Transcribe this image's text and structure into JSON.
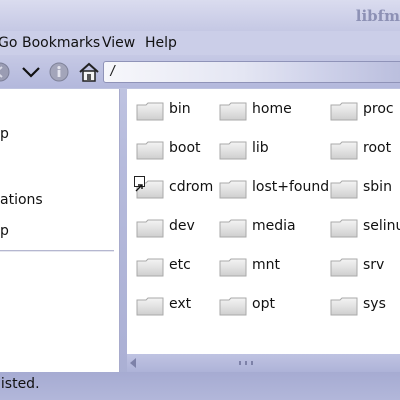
{
  "window": {
    "title": "libfm"
  },
  "menubar": {
    "items": [
      "Go",
      "Bookmarks",
      "View",
      "Help"
    ]
  },
  "toolbar": {
    "icons": [
      "back-icon",
      "dropdown-chevron-icon",
      "info-icon",
      "home-icon"
    ],
    "location": "/"
  },
  "sidepane": {
    "items": [
      "p",
      "ations",
      "p"
    ]
  },
  "files": [
    {
      "name": "bin"
    },
    {
      "name": "home"
    },
    {
      "name": "proc"
    },
    {
      "name": "boot"
    },
    {
      "name": "lib"
    },
    {
      "name": "root"
    },
    {
      "name": "cdrom",
      "symlink": true
    },
    {
      "name": "lost+found"
    },
    {
      "name": "sbin"
    },
    {
      "name": "dev"
    },
    {
      "name": "media"
    },
    {
      "name": "selinux"
    },
    {
      "name": "etc"
    },
    {
      "name": "mnt"
    },
    {
      "name": "srv"
    },
    {
      "name": "ext"
    },
    {
      "name": "opt"
    },
    {
      "name": "sys"
    }
  ],
  "statusbar": {
    "text": "listed."
  },
  "colors": {
    "chrome": "#c9cde6",
    "accent": "#8d91b5",
    "folder": "#e2e2e2"
  }
}
